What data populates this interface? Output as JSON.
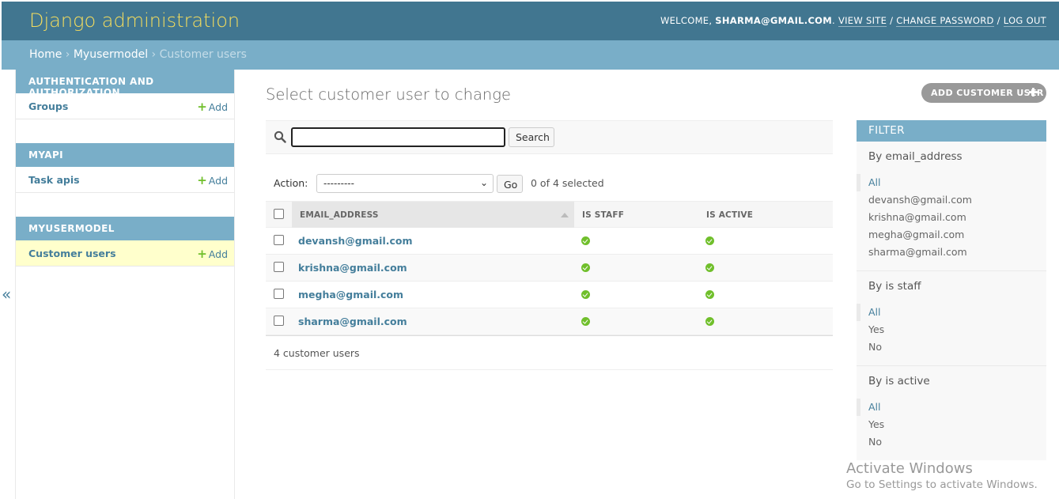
{
  "header": {
    "branding": "Django administration",
    "welcome": "WELCOME,",
    "username": "SHARMA@GMAIL.COM",
    "view_site": "VIEW SITE",
    "change_password": "CHANGE PASSWORD",
    "log_out": "LOG OUT"
  },
  "breadcrumbs": {
    "home": "Home",
    "app": "Myusermodel",
    "current": "Customer users"
  },
  "sidebar": {
    "modules": [
      {
        "caption": "AUTHENTICATION AND AUTHORIZATION",
        "model": "Groups",
        "add": "Add"
      },
      {
        "caption": "MYAPI",
        "model": "Task apis",
        "add": "Add"
      },
      {
        "caption": "MYUSERMODEL",
        "model": "Customer users",
        "add": "Add"
      }
    ],
    "toggle": "«"
  },
  "main": {
    "title": "Select customer user to change",
    "add_button": "ADD CUSTOMER USER",
    "search": {
      "value": "",
      "button": "Search"
    },
    "actions": {
      "label": "Action:",
      "selected_option": "---------",
      "go": "Go",
      "counter": "0 of 4 selected"
    },
    "table": {
      "headers": [
        "EMAIL_ADDRESS",
        "IS STAFF",
        "IS ACTIVE"
      ],
      "rows": [
        {
          "email": "devansh@gmail.com",
          "is_staff": true,
          "is_active": true
        },
        {
          "email": "krishna@gmail.com",
          "is_staff": true,
          "is_active": true
        },
        {
          "email": "megha@gmail.com",
          "is_staff": true,
          "is_active": true
        },
        {
          "email": "sharma@gmail.com",
          "is_staff": true,
          "is_active": true
        }
      ]
    },
    "paginator": "4 customer users"
  },
  "filter": {
    "title": "FILTER",
    "groups": [
      {
        "title": "By email_address",
        "options": [
          "All",
          "devansh@gmail.com",
          "krishna@gmail.com",
          "megha@gmail.com",
          "sharma@gmail.com"
        ]
      },
      {
        "title": "By is staff",
        "options": [
          "All",
          "Yes",
          "No"
        ]
      },
      {
        "title": "By is active",
        "options": [
          "All",
          "Yes",
          "No"
        ]
      }
    ]
  },
  "watermark": {
    "line1": "Activate Windows",
    "line2": "Go to Settings to activate Windows."
  },
  "colors": {
    "header": "#417690",
    "branding": "#f5dd5d",
    "module": "#79aec8",
    "link": "#447e9b",
    "yes": "#70bf2b",
    "current": "#ffffcc"
  }
}
